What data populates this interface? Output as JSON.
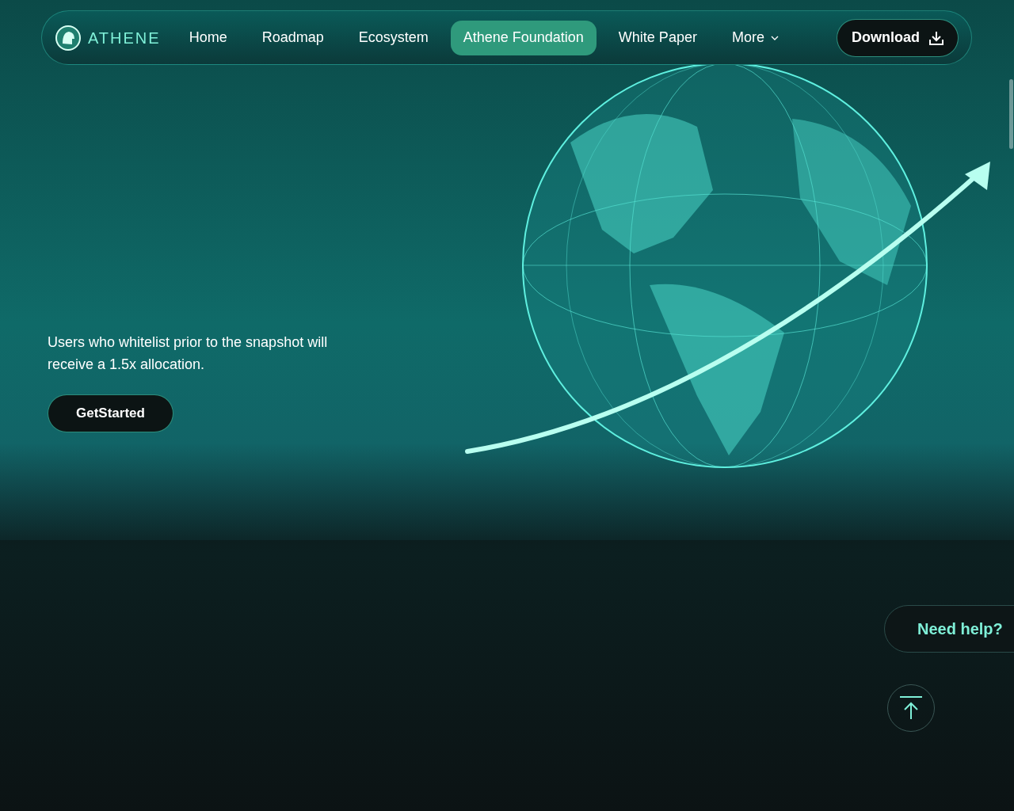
{
  "nav": {
    "logo": "ATHENE",
    "items": [
      {
        "label": "Home",
        "selected": false
      },
      {
        "label": "Roadmap",
        "selected": false
      },
      {
        "label": "Ecosystem",
        "selected": false
      },
      {
        "label": "Athene Foundation",
        "selected": true
      },
      {
        "label": "White Paper",
        "selected": false
      },
      {
        "label": "More",
        "selected": false,
        "kind": "dropdown"
      }
    ],
    "download": "Download"
  },
  "hero": {
    "text": "Users who whitelist prior to the snapshot will receive a 1.5x allocation.",
    "button": "GetStarted"
  },
  "help": "Need help?"
}
